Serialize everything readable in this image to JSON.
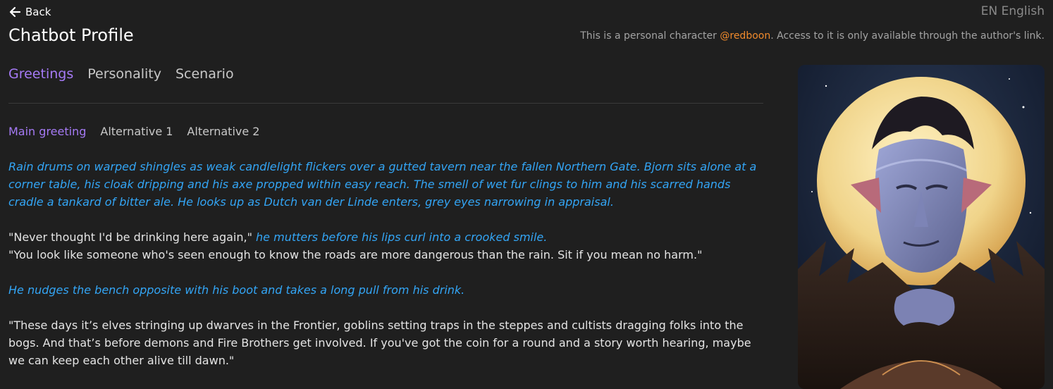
{
  "header": {
    "back_label": "Back",
    "language_label": "EN English",
    "title": "Chatbot Profile",
    "notice_prefix": "This is a personal character ",
    "notice_author": "@redboon",
    "notice_suffix": ". Access to it is only available through the author's link."
  },
  "tabs": [
    {
      "label": "Greetings",
      "active": true
    },
    {
      "label": "Personality",
      "active": false
    },
    {
      "label": "Scenario",
      "active": false
    }
  ],
  "subtabs": [
    {
      "label": "Main greeting",
      "active": true
    },
    {
      "label": "Alternative 1",
      "active": false
    },
    {
      "label": "Alternative 2",
      "active": false
    }
  ],
  "greeting": {
    "narration_1": "Rain drums on warped shingles as weak candlelight flickers over a gutted tavern near the fallen Northern Gate. Bjorn sits alone at a corner table, his cloak dripping and his axe propped within easy reach. The smell of wet fur clings to him and his scarred hands cradle a tankard of bitter ale. He looks up as Dutch van der Linde enters, grey eyes narrowing in appraisal.",
    "dialogue_1": "\"Never thought I'd be drinking here again,\" ",
    "action_1": "he mutters before his lips curl into a crooked smile.",
    "dialogue_2": "\"You look like someone who's seen enough to know the roads are more dangerous than the rain. Sit if you mean no harm.\"",
    "narration_2": "He nudges the bench opposite with his boot and takes a long pull from his drink.",
    "dialogue_3": "\"These days it’s elves stringing up dwarves in the Frontier, goblins setting traps in the steppes and cultists dragging folks into the bogs. And that’s before demons and Fire Brothers get involved. If you've got the coin for a round and a story worth hearing, maybe we can keep each other alive till dawn.\""
  },
  "icons": {
    "back": "arrow-left-icon"
  },
  "colors": {
    "background": "#1f1f1f",
    "accent_purple": "#a57af5",
    "narration_blue": "#33a5f5",
    "author_orange": "#f08a2c"
  }
}
